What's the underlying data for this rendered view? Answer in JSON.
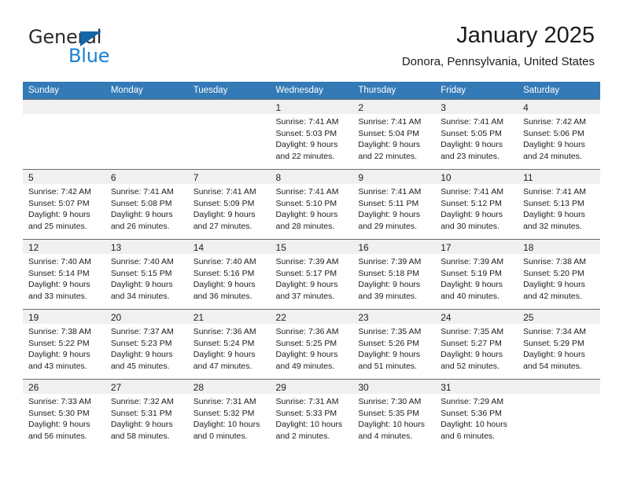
{
  "brand": {
    "name_part1": "General",
    "name_part2": "Blue",
    "accent_color": "#1a7fd4",
    "triangle_color": "#1565a8"
  },
  "header": {
    "title": "January 2025",
    "subtitle": "Donora, Pennsylvania, United States"
  },
  "theme": {
    "header_row_bg": "#337ab7",
    "header_row_text": "#ffffff",
    "daynum_band_bg": "#f0f0f0",
    "cell_border": "#6c6c6c"
  },
  "weekday_headers": [
    "Sunday",
    "Monday",
    "Tuesday",
    "Wednesday",
    "Thursday",
    "Friday",
    "Saturday"
  ],
  "weeks": [
    [
      {
        "day": "",
        "lines": [
          "",
          "",
          "",
          ""
        ]
      },
      {
        "day": "",
        "lines": [
          "",
          "",
          "",
          ""
        ]
      },
      {
        "day": "",
        "lines": [
          "",
          "",
          "",
          ""
        ]
      },
      {
        "day": "1",
        "lines": [
          "Sunrise: 7:41 AM",
          "Sunset: 5:03 PM",
          "Daylight: 9 hours",
          "and 22 minutes."
        ]
      },
      {
        "day": "2",
        "lines": [
          "Sunrise: 7:41 AM",
          "Sunset: 5:04 PM",
          "Daylight: 9 hours",
          "and 22 minutes."
        ]
      },
      {
        "day": "3",
        "lines": [
          "Sunrise: 7:41 AM",
          "Sunset: 5:05 PM",
          "Daylight: 9 hours",
          "and 23 minutes."
        ]
      },
      {
        "day": "4",
        "lines": [
          "Sunrise: 7:42 AM",
          "Sunset: 5:06 PM",
          "Daylight: 9 hours",
          "and 24 minutes."
        ]
      }
    ],
    [
      {
        "day": "5",
        "lines": [
          "Sunrise: 7:42 AM",
          "Sunset: 5:07 PM",
          "Daylight: 9 hours",
          "and 25 minutes."
        ]
      },
      {
        "day": "6",
        "lines": [
          "Sunrise: 7:41 AM",
          "Sunset: 5:08 PM",
          "Daylight: 9 hours",
          "and 26 minutes."
        ]
      },
      {
        "day": "7",
        "lines": [
          "Sunrise: 7:41 AM",
          "Sunset: 5:09 PM",
          "Daylight: 9 hours",
          "and 27 minutes."
        ]
      },
      {
        "day": "8",
        "lines": [
          "Sunrise: 7:41 AM",
          "Sunset: 5:10 PM",
          "Daylight: 9 hours",
          "and 28 minutes."
        ]
      },
      {
        "day": "9",
        "lines": [
          "Sunrise: 7:41 AM",
          "Sunset: 5:11 PM",
          "Daylight: 9 hours",
          "and 29 minutes."
        ]
      },
      {
        "day": "10",
        "lines": [
          "Sunrise: 7:41 AM",
          "Sunset: 5:12 PM",
          "Daylight: 9 hours",
          "and 30 minutes."
        ]
      },
      {
        "day": "11",
        "lines": [
          "Sunrise: 7:41 AM",
          "Sunset: 5:13 PM",
          "Daylight: 9 hours",
          "and 32 minutes."
        ]
      }
    ],
    [
      {
        "day": "12",
        "lines": [
          "Sunrise: 7:40 AM",
          "Sunset: 5:14 PM",
          "Daylight: 9 hours",
          "and 33 minutes."
        ]
      },
      {
        "day": "13",
        "lines": [
          "Sunrise: 7:40 AM",
          "Sunset: 5:15 PM",
          "Daylight: 9 hours",
          "and 34 minutes."
        ]
      },
      {
        "day": "14",
        "lines": [
          "Sunrise: 7:40 AM",
          "Sunset: 5:16 PM",
          "Daylight: 9 hours",
          "and 36 minutes."
        ]
      },
      {
        "day": "15",
        "lines": [
          "Sunrise: 7:39 AM",
          "Sunset: 5:17 PM",
          "Daylight: 9 hours",
          "and 37 minutes."
        ]
      },
      {
        "day": "16",
        "lines": [
          "Sunrise: 7:39 AM",
          "Sunset: 5:18 PM",
          "Daylight: 9 hours",
          "and 39 minutes."
        ]
      },
      {
        "day": "17",
        "lines": [
          "Sunrise: 7:39 AM",
          "Sunset: 5:19 PM",
          "Daylight: 9 hours",
          "and 40 minutes."
        ]
      },
      {
        "day": "18",
        "lines": [
          "Sunrise: 7:38 AM",
          "Sunset: 5:20 PM",
          "Daylight: 9 hours",
          "and 42 minutes."
        ]
      }
    ],
    [
      {
        "day": "19",
        "lines": [
          "Sunrise: 7:38 AM",
          "Sunset: 5:22 PM",
          "Daylight: 9 hours",
          "and 43 minutes."
        ]
      },
      {
        "day": "20",
        "lines": [
          "Sunrise: 7:37 AM",
          "Sunset: 5:23 PM",
          "Daylight: 9 hours",
          "and 45 minutes."
        ]
      },
      {
        "day": "21",
        "lines": [
          "Sunrise: 7:36 AM",
          "Sunset: 5:24 PM",
          "Daylight: 9 hours",
          "and 47 minutes."
        ]
      },
      {
        "day": "22",
        "lines": [
          "Sunrise: 7:36 AM",
          "Sunset: 5:25 PM",
          "Daylight: 9 hours",
          "and 49 minutes."
        ]
      },
      {
        "day": "23",
        "lines": [
          "Sunrise: 7:35 AM",
          "Sunset: 5:26 PM",
          "Daylight: 9 hours",
          "and 51 minutes."
        ]
      },
      {
        "day": "24",
        "lines": [
          "Sunrise: 7:35 AM",
          "Sunset: 5:27 PM",
          "Daylight: 9 hours",
          "and 52 minutes."
        ]
      },
      {
        "day": "25",
        "lines": [
          "Sunrise: 7:34 AM",
          "Sunset: 5:29 PM",
          "Daylight: 9 hours",
          "and 54 minutes."
        ]
      }
    ],
    [
      {
        "day": "26",
        "lines": [
          "Sunrise: 7:33 AM",
          "Sunset: 5:30 PM",
          "Daylight: 9 hours",
          "and 56 minutes."
        ]
      },
      {
        "day": "27",
        "lines": [
          "Sunrise: 7:32 AM",
          "Sunset: 5:31 PM",
          "Daylight: 9 hours",
          "and 58 minutes."
        ]
      },
      {
        "day": "28",
        "lines": [
          "Sunrise: 7:31 AM",
          "Sunset: 5:32 PM",
          "Daylight: 10 hours",
          "and 0 minutes."
        ]
      },
      {
        "day": "29",
        "lines": [
          "Sunrise: 7:31 AM",
          "Sunset: 5:33 PM",
          "Daylight: 10 hours",
          "and 2 minutes."
        ]
      },
      {
        "day": "30",
        "lines": [
          "Sunrise: 7:30 AM",
          "Sunset: 5:35 PM",
          "Daylight: 10 hours",
          "and 4 minutes."
        ]
      },
      {
        "day": "31",
        "lines": [
          "Sunrise: 7:29 AM",
          "Sunset: 5:36 PM",
          "Daylight: 10 hours",
          "and 6 minutes."
        ]
      },
      {
        "day": "",
        "lines": [
          "",
          "",
          "",
          ""
        ]
      }
    ]
  ]
}
